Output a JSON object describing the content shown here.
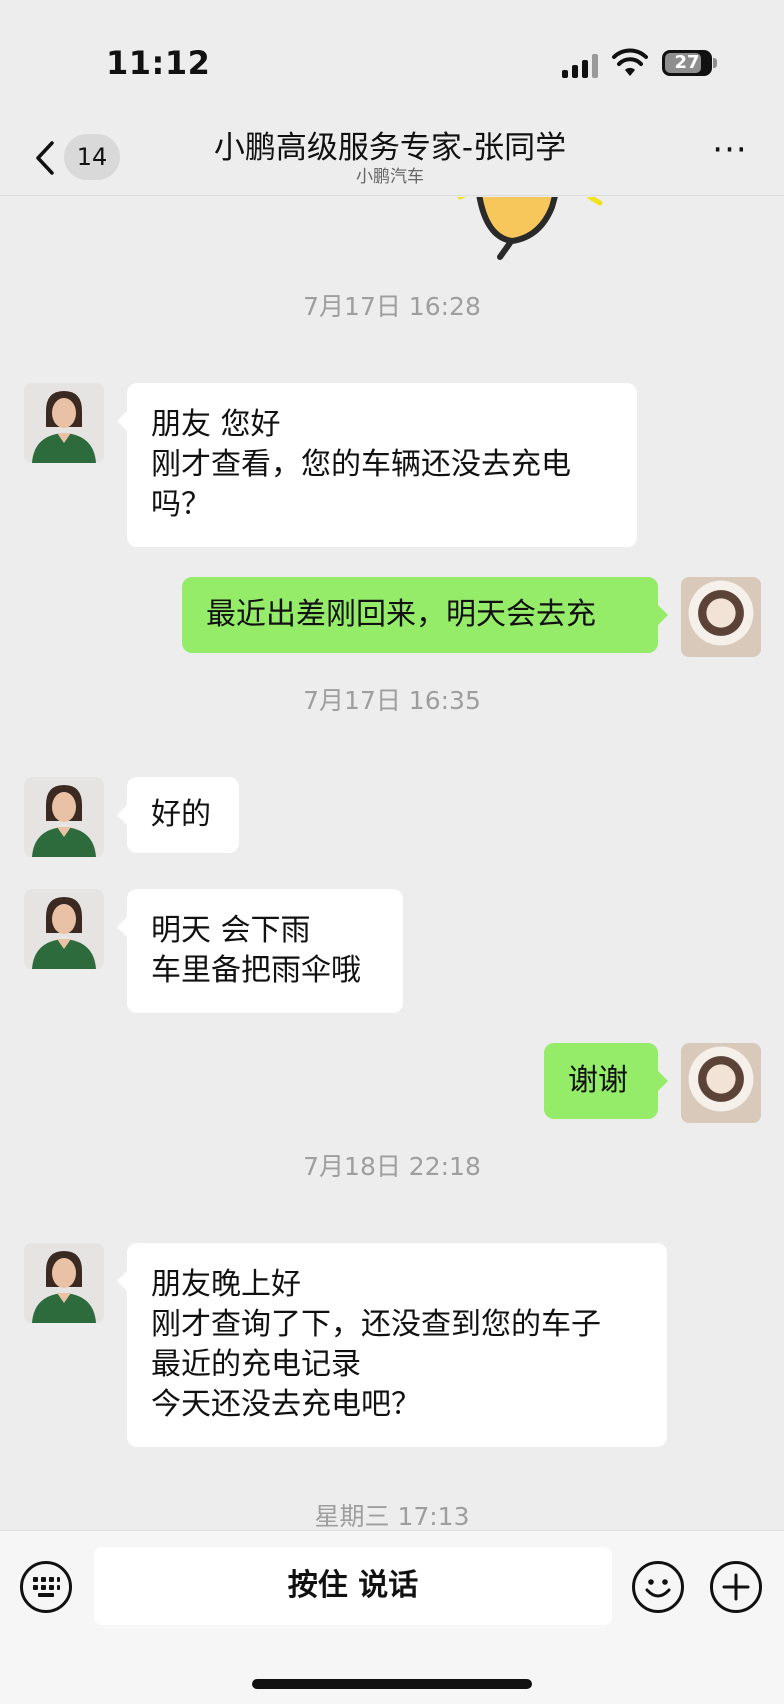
{
  "status_bar": {
    "time": "11:12",
    "battery": "27"
  },
  "header": {
    "back_count": "14",
    "title": "小鹏高级服务专家-张同学",
    "subtitle": "小鹏汽车",
    "more_label": "···"
  },
  "messages": [
    {
      "type": "timestamp",
      "text": "7月17日 16:28"
    },
    {
      "type": "incoming",
      "text": "朋友  您好\n刚才查看，您的车辆还没去充电\n吗？"
    },
    {
      "type": "outgoing",
      "text": "最近出差刚回来，明天会去充"
    },
    {
      "type": "timestamp",
      "text": "7月17日 16:35"
    },
    {
      "type": "incoming",
      "text": "好的"
    },
    {
      "type": "incoming",
      "text": "明天 会下雨\n车里备把雨伞哦"
    },
    {
      "type": "outgoing",
      "text": "谢谢"
    },
    {
      "type": "timestamp",
      "text": "7月18日 22:18"
    },
    {
      "type": "incoming",
      "text": "朋友晚上好\n刚才查询了下，还没查到您的车子\n最近的充电记录\n今天还没去充电吧？"
    },
    {
      "type": "timestamp",
      "text": "星期三 17:13"
    }
  ],
  "input_bar": {
    "hold_to_talk_label": "按住 说话",
    "left_icon": "keyboard-icon",
    "right_icons": [
      "emoji-icon",
      "plus-icon"
    ]
  },
  "colors": {
    "background": "#ededed",
    "outgoing_bubble": "#95ec69",
    "incoming_bubble": "#ffffff",
    "timestamp_text": "#9e9e9e"
  }
}
